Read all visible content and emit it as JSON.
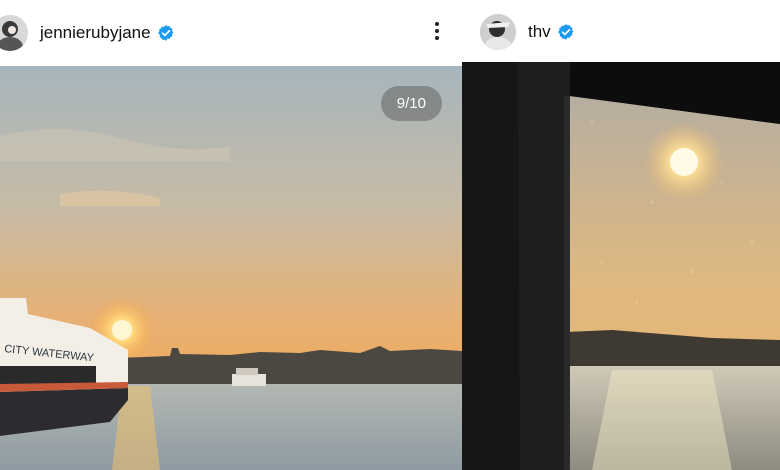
{
  "posts": [
    {
      "username": "jennierubyjane",
      "verified": true,
      "counter": "9/10",
      "ferry_text": "CITY WATERWAY"
    },
    {
      "username": "thv",
      "verified": true
    }
  ],
  "colors": {
    "verified_badge": "#1d9bf0",
    "sky_top": "#a9b8c0",
    "sky_horizon": "#f0a548",
    "water": "#a2aeb4",
    "sun": "#fff3b0",
    "window_frame": "#141414"
  },
  "icons": {
    "verified": "verified-check-icon",
    "more": "more-options-vertical-icon"
  }
}
